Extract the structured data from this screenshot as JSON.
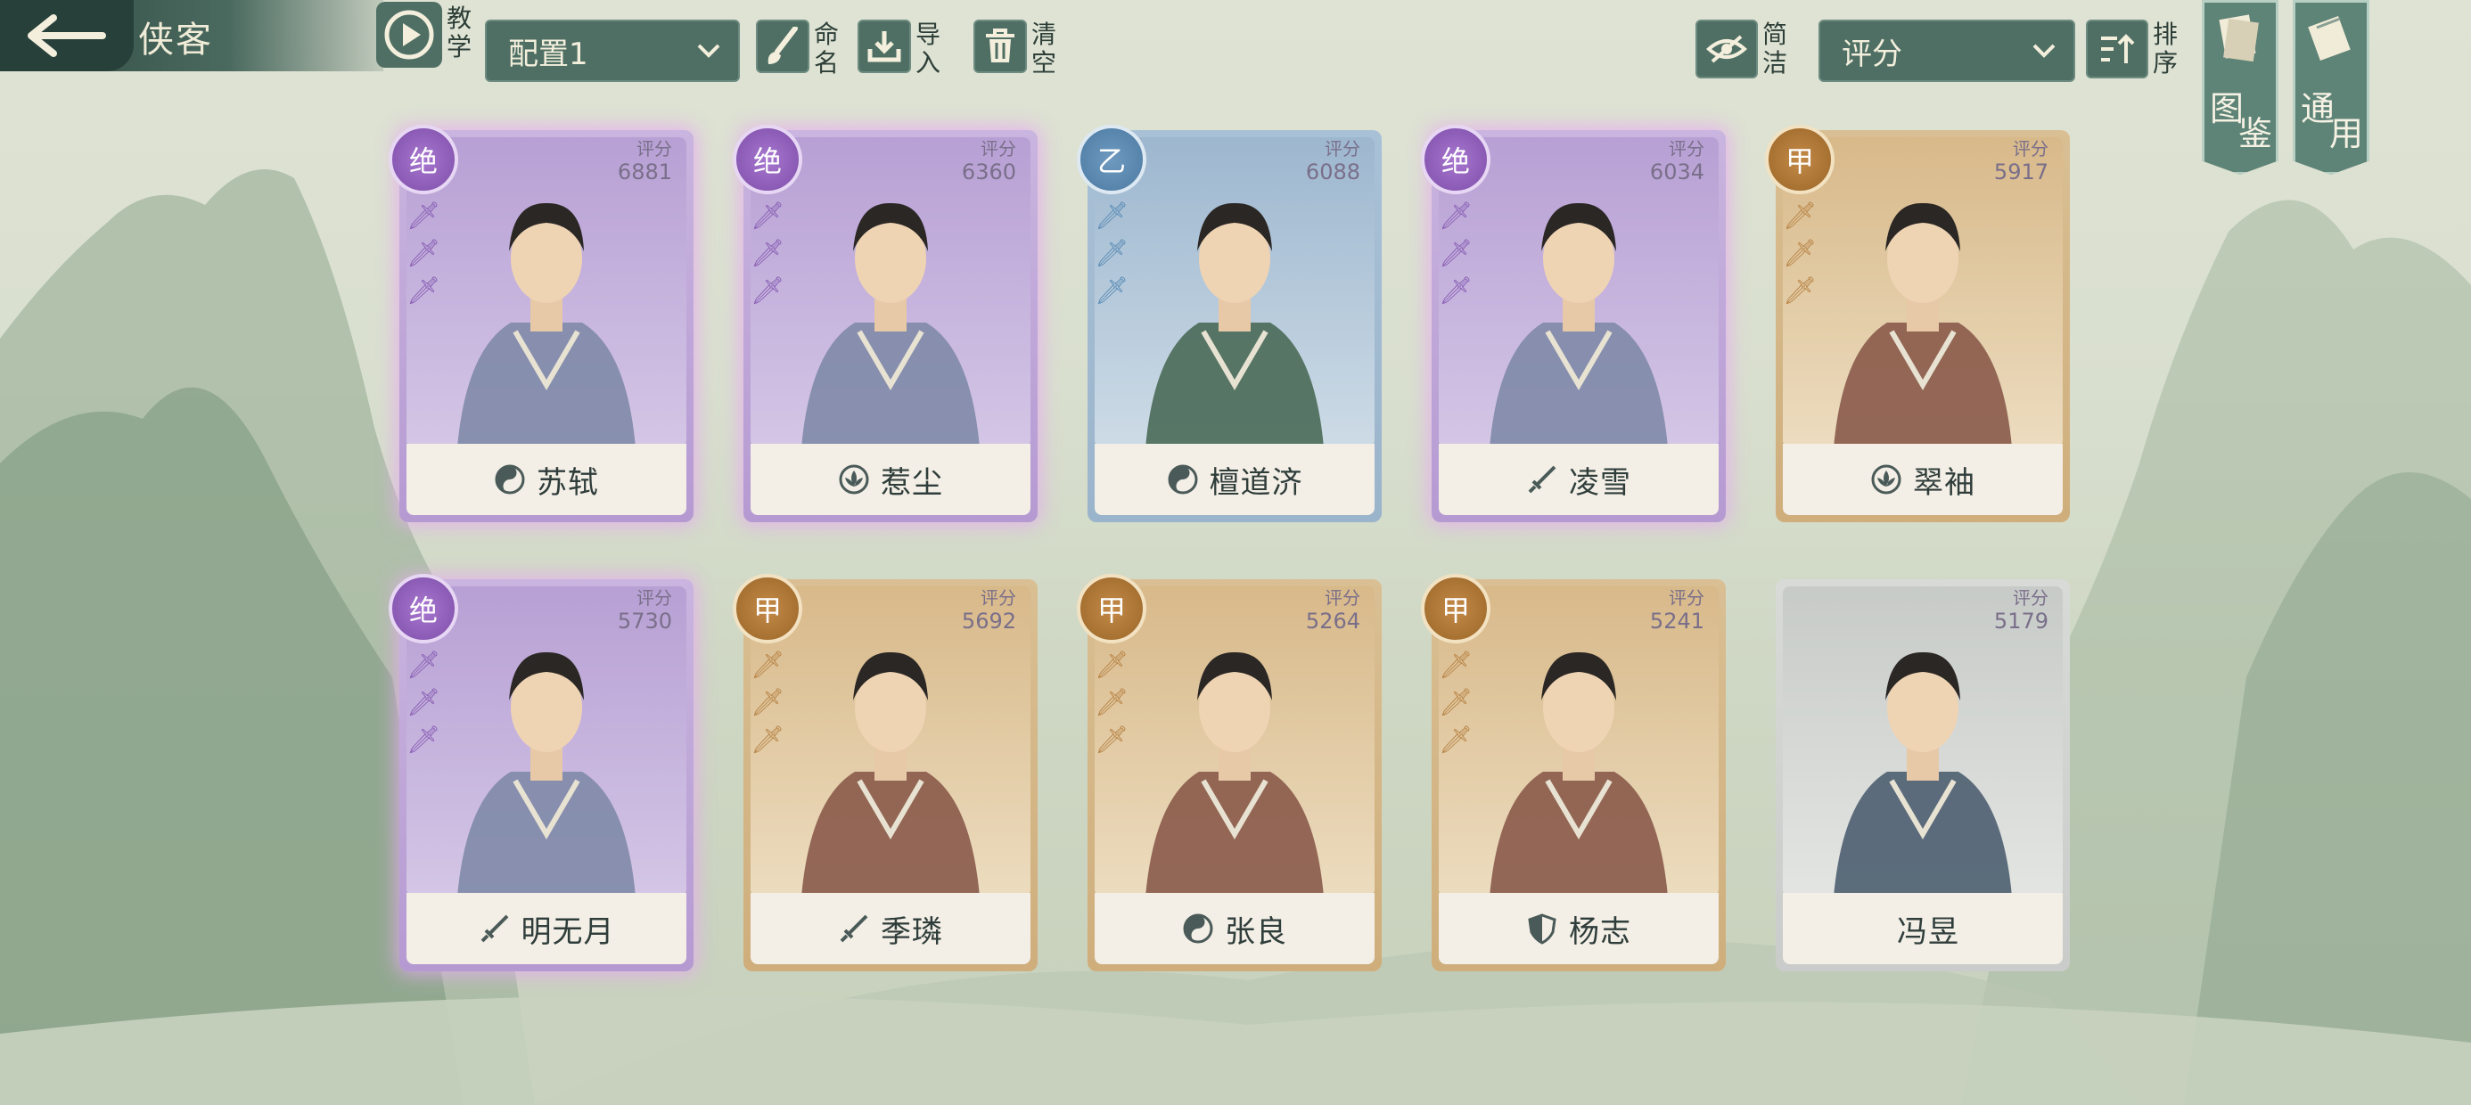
{
  "header": {
    "title": "侠客",
    "tutorial_label": [
      "教",
      "学"
    ],
    "config_select": "配置1",
    "rename_label": [
      "命",
      "名"
    ],
    "import_label": [
      "导",
      "入"
    ],
    "clear_label": [
      "清",
      "空"
    ],
    "simple_label": [
      "简",
      "洁"
    ],
    "sort_select": "评分",
    "sort_label": [
      "排",
      "序"
    ]
  },
  "side_tabs": [
    {
      "top": "图",
      "bottom": "鉴"
    },
    {
      "top": "通",
      "bottom": "用"
    }
  ],
  "cards": [
    {
      "name": "苏轼",
      "score_label": "评分",
      "score": "6881",
      "rank": "绝",
      "tier": "purple",
      "class_icon": "taiji-icon",
      "stars": 3
    },
    {
      "name": "惹尘",
      "score_label": "评分",
      "score": "6360",
      "rank": "绝",
      "tier": "purple",
      "class_icon": "lotus-icon",
      "stars": 3
    },
    {
      "name": "檀道济",
      "score_label": "评分",
      "score": "6088",
      "rank": "乙",
      "tier": "blue",
      "class_icon": "taiji-icon",
      "stars": 3
    },
    {
      "name": "凌雪",
      "score_label": "评分",
      "score": "6034",
      "rank": "绝",
      "tier": "purple",
      "class_icon": "sword-icon",
      "stars": 3
    },
    {
      "name": "翠袖",
      "score_label": "评分",
      "score": "5917",
      "rank": "甲",
      "tier": "gold",
      "class_icon": "lotus-icon",
      "stars": 3
    },
    {
      "name": "明无月",
      "score_label": "评分",
      "score": "5730",
      "rank": "绝",
      "tier": "purple",
      "class_icon": "sword-icon",
      "stars": 3
    },
    {
      "name": "季璘",
      "score_label": "评分",
      "score": "5692",
      "rank": "甲",
      "tier": "gold",
      "class_icon": "sword-icon",
      "stars": 3
    },
    {
      "name": "张良",
      "score_label": "评分",
      "score": "5264",
      "rank": "甲",
      "tier": "gold",
      "class_icon": "taiji-icon",
      "stars": 3
    },
    {
      "name": "杨志",
      "score_label": "评分",
      "score": "5241",
      "rank": "甲",
      "tier": "gold",
      "class_icon": "shield-icon",
      "stars": 3
    },
    {
      "name": "冯昱",
      "score_label": "评分",
      "score": "5179",
      "rank": "",
      "tier": "grey",
      "class_icon": "",
      "stars": 0
    }
  ]
}
